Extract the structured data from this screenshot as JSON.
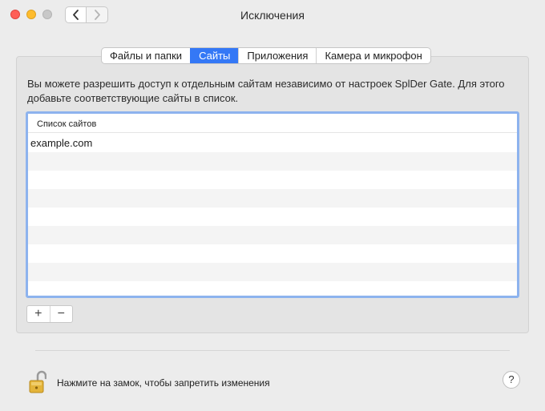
{
  "window": {
    "title": "Исключения"
  },
  "tabs": [
    {
      "label": "Файлы и папки",
      "active": false
    },
    {
      "label": "Сайты",
      "active": true
    },
    {
      "label": "Приложения",
      "active": false
    },
    {
      "label": "Камера и микрофон",
      "active": false
    }
  ],
  "description": "Вы можете разрешить доступ к отдельным сайтам независимо от настроек SplDer Gate. Для этого добавьте соответствующие сайты в список.",
  "site_list": {
    "header": "Список сайтов",
    "rows": [
      "example.com",
      "",
      "",
      "",
      "",
      "",
      "",
      "",
      ""
    ]
  },
  "list_controls": {
    "add_label": "+",
    "remove_label": "−"
  },
  "footer": {
    "lock_text": "Нажмите на замок, чтобы запретить изменения",
    "help_label": "?"
  },
  "colors": {
    "accent": "#3478f6",
    "close": "#fe5f57",
    "minimize": "#febc2e",
    "list_focus_ring": "#8db3ee",
    "lock_body": "#e4b43a"
  }
}
